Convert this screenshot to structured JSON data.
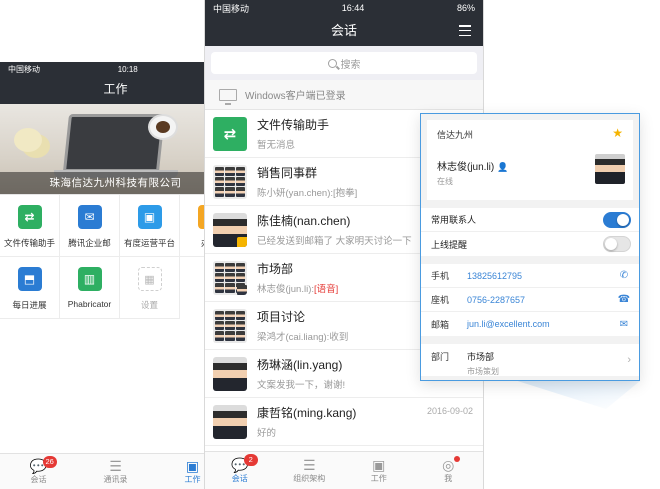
{
  "left_phone": {
    "status": {
      "carrier": "中国移动",
      "time": "10:18"
    },
    "title": "工作",
    "banner_caption": "珠海信达九州科技有限公司",
    "apps": [
      {
        "label": "文件传输助手",
        "icon": "file-transfer-icon",
        "color": "#2eaf62",
        "glyph": "⇄"
      },
      {
        "label": "腾讯企业邮",
        "icon": "mail-icon",
        "color": "#2b7cd3",
        "glyph": "✉"
      },
      {
        "label": "有度运营平台",
        "icon": "briefcase-icon",
        "color": "#2d9be8",
        "glyph": "▣"
      },
      {
        "label": "办公",
        "icon": "office-icon",
        "color": "#f4a623",
        "glyph": "▤"
      },
      {
        "label": "每日进展",
        "icon": "daily-progress-icon",
        "color": "#2b7cd3",
        "glyph": "⬒"
      },
      {
        "label": "Phabricator",
        "icon": "chart-icon",
        "color": "#2eaf62",
        "glyph": "▥"
      },
      {
        "label": "设置",
        "icon": "grid-settings-icon",
        "color": "#ffffff",
        "glyph": "▦"
      }
    ],
    "tabs": [
      {
        "label": "会话",
        "icon": "chat-icon",
        "glyph": "💬",
        "badge": "26",
        "active": false
      },
      {
        "label": "通讯录",
        "icon": "contacts-icon",
        "glyph": "☰",
        "active": false
      },
      {
        "label": "工作",
        "icon": "work-icon",
        "glyph": "▣",
        "active": true
      }
    ]
  },
  "right_phone": {
    "status": {
      "carrier": "中国移动",
      "time": "16:44",
      "battery": "86%"
    },
    "title": "会话",
    "search_placeholder": "搜索",
    "pc_notice": "Windows客户端已登录",
    "conversations": [
      {
        "name": "文件传输助手",
        "message": "暂无消息",
        "avatar": "file",
        "time": ""
      },
      {
        "name": "销售同事群",
        "message": "陈小妍(yan.chen):[抱拳]",
        "avatar": "group",
        "time": ""
      },
      {
        "name": "陈佳楠(nan.chen)",
        "message": "已经发送到邮箱了 大家明天讨论一下",
        "avatar": "person",
        "time": ""
      },
      {
        "name": "市场部",
        "message": "林志俊(jun.li):",
        "message_tag": "[语音]",
        "avatar": "group",
        "time": ""
      },
      {
        "name": "项目讨论",
        "message": "梁鸿才(cai.liang):收到",
        "avatar": "group",
        "time": ""
      },
      {
        "name": "杨琳涵(lin.yang)",
        "message": "文案发我一下，谢谢!",
        "avatar": "person",
        "time": ""
      },
      {
        "name": "康哲铭(ming.kang)",
        "message": "好的",
        "avatar": "person",
        "time": "2016-09-02"
      }
    ],
    "tabs": [
      {
        "label": "会话",
        "icon": "chat-icon",
        "glyph": "💬",
        "badge": "2",
        "active": true
      },
      {
        "label": "组织架构",
        "icon": "org-structure-icon",
        "glyph": "☰",
        "active": false
      },
      {
        "label": "工作",
        "icon": "work-icon",
        "glyph": "▣",
        "active": false
      },
      {
        "label": "我",
        "icon": "profile-icon",
        "glyph": "◎",
        "active": false,
        "dot": true
      }
    ]
  },
  "contact_card": {
    "org": "信达九州",
    "name": "林志俊(jun.li)",
    "status": "在线",
    "toggles": [
      {
        "label": "常用联系人",
        "on": true
      },
      {
        "label": "上线提醒",
        "on": false
      }
    ],
    "fields": [
      {
        "label": "手机",
        "value": "13825612795",
        "icon": "phone-icon",
        "glyph": "✆"
      },
      {
        "label": "座机",
        "value": "0756-2287657",
        "icon": "landline-icon",
        "glyph": "☎"
      },
      {
        "label": "邮箱",
        "value": "jun.li@excellent.com",
        "icon": "email-icon",
        "glyph": "✉"
      }
    ],
    "department": {
      "label": "部门",
      "value": "市场部",
      "sub": "市场策划"
    }
  }
}
